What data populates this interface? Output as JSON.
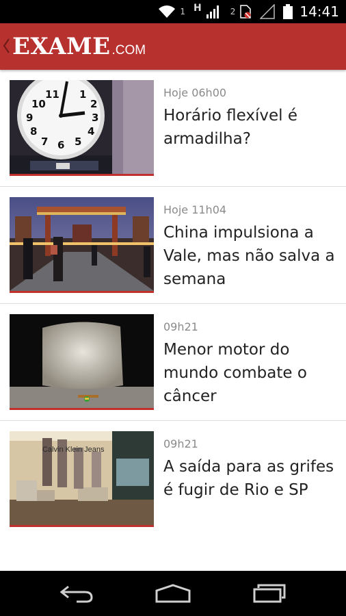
{
  "status_bar": {
    "time": "14:41",
    "network_label": "H",
    "wifi_badge": "1",
    "sim_badge": "2",
    "icons": [
      "wifi-icon",
      "signal-icon",
      "sim-icon",
      "signal-empty-icon",
      "battery-icon"
    ]
  },
  "app_bar": {
    "logo_main": "EXAME",
    "logo_suffix": ".COM",
    "brand_color": "#b7312f"
  },
  "articles": [
    {
      "time": "Hoje 06h00",
      "title": "Horário flexível é armadilha?",
      "image": "clock-photo"
    },
    {
      "time": "Hoje 11h04",
      "title": "China impulsiona a Vale, mas não salva a semana",
      "image": "beijing-street-photo"
    },
    {
      "time": "09h21",
      "title": "Menor motor do mundo combate o câncer",
      "image": "tiny-motor-photo"
    },
    {
      "time": "09h21",
      "title": "A saída para as grifes é fugir de Rio e SP",
      "image": "calvin-klein-store-photo",
      "image_text": "Calvin Klein Jeans"
    }
  ],
  "nav_bar": {
    "icons": [
      "back-icon",
      "home-icon",
      "recent-apps-icon"
    ]
  }
}
